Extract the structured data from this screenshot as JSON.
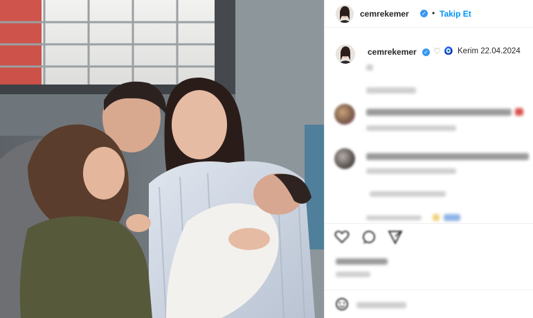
{
  "post": {
    "username": "cemrekemer",
    "follow_label": "Takip Et",
    "separator": "•",
    "verified_icon": "verified-badge-icon",
    "caption": {
      "username": "cemrekemer",
      "text": "Kerim 22.04.2024",
      "emoji_heart": "♡",
      "emoji_evil_eye": "🧿"
    }
  },
  "colors": {
    "link_blue": "#0095f6",
    "verified_blue": "#3897f0",
    "text": "#262626"
  },
  "icons": {
    "like": "heart-icon",
    "comment": "comment-icon",
    "share": "share-icon",
    "emoji": "emoji-icon"
  }
}
